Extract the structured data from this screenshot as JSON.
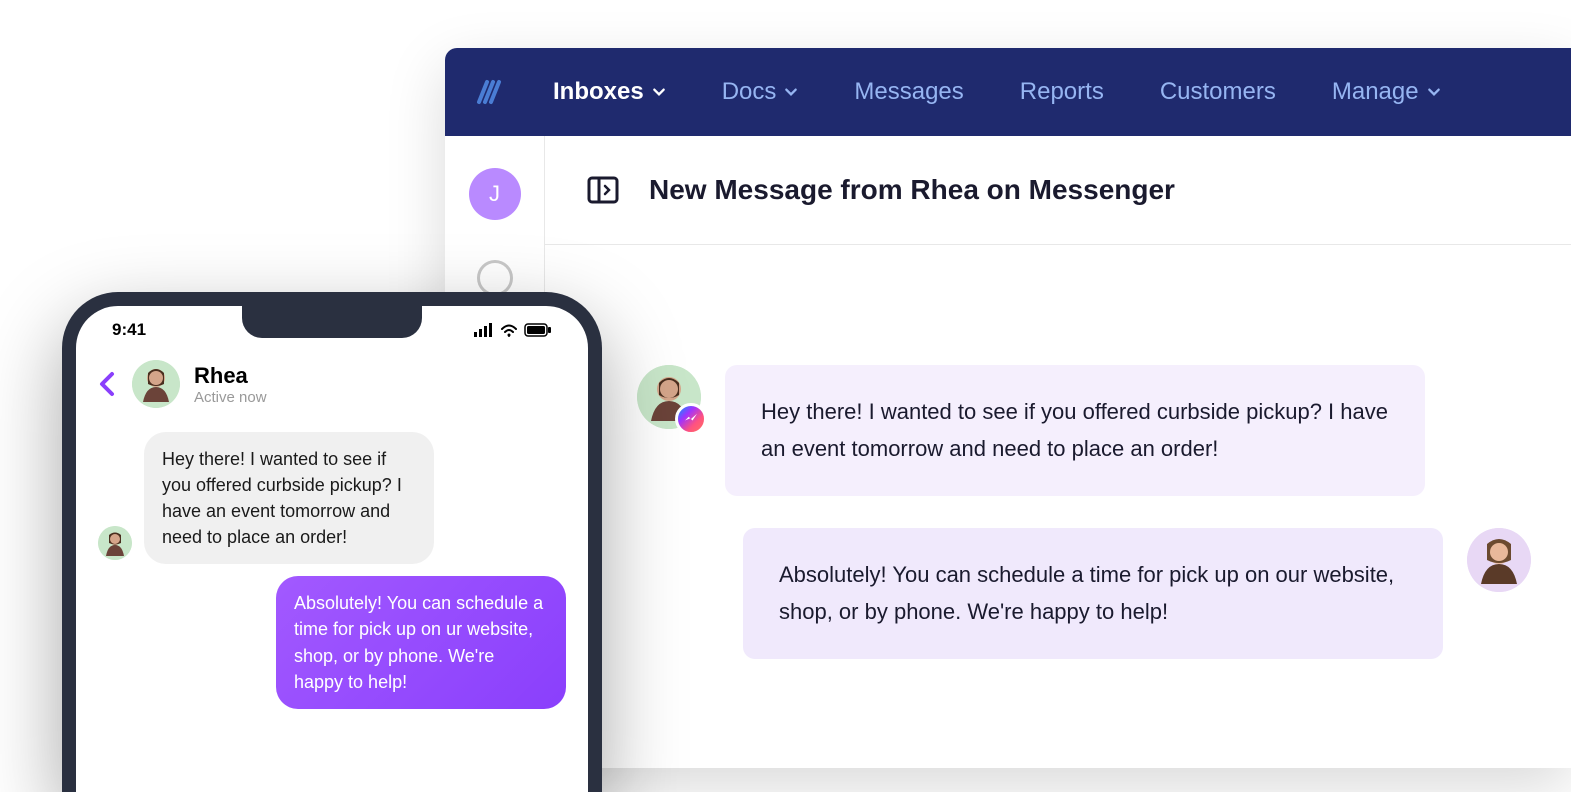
{
  "navbar": {
    "items": [
      "Inboxes",
      "Docs",
      "Messages",
      "Reports",
      "Customers",
      "Manage"
    ]
  },
  "sidebar": {
    "avatar_initial": "J"
  },
  "thread": {
    "title": "New Message from Rhea on Messenger",
    "messages": [
      {
        "sender": "customer",
        "text": "Hey there! I wanted to see if you offered curbside pickup? I have an event tomorrow and need to place an order!"
      },
      {
        "sender": "agent",
        "text": "Absolutely! You can schedule a time for pick up on our website, shop, or by phone. We're happy to help!"
      }
    ]
  },
  "phone": {
    "time": "9:41",
    "contact_name": "Rhea",
    "contact_status": "Active now",
    "messages": [
      {
        "type": "received",
        "text": "Hey there! I wanted to see if you offered curbside pickup? I have an event tomorrow and need to place an order!"
      },
      {
        "type": "sent",
        "text": "Absolutely! You can schedule a time for pick up on ur website, shop, or by phone. We're happy to help!"
      }
    ]
  }
}
